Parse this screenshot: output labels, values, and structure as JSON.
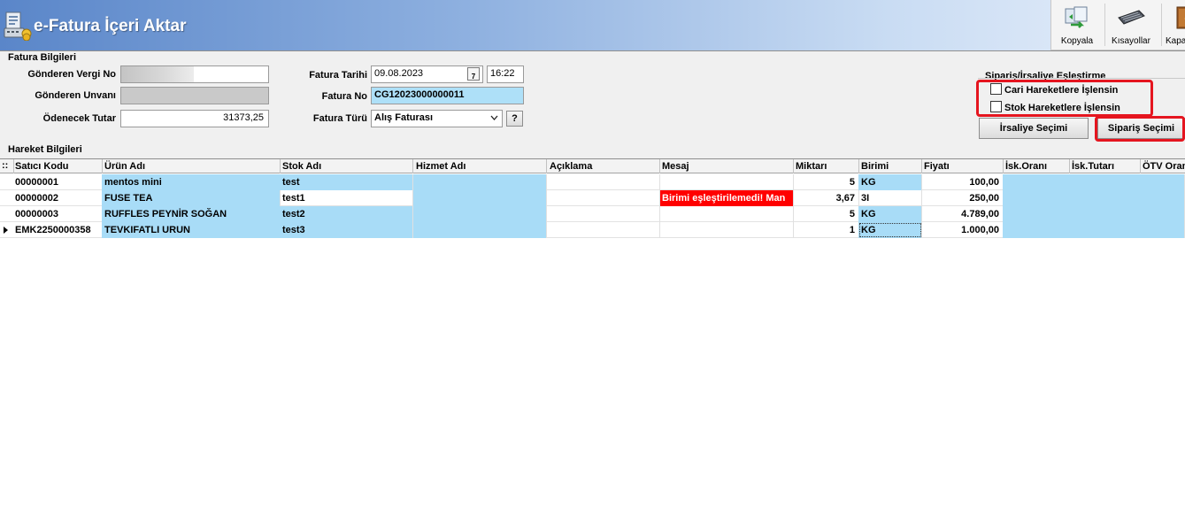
{
  "window": {
    "title": "e-Fatura İçeri Aktar"
  },
  "toolbar": {
    "buttons": [
      {
        "label": "Kopyala",
        "icon": "copy-icon"
      },
      {
        "label": "Kısayollar",
        "icon": "keyboard-icon"
      },
      {
        "label": "Kapat",
        "icon": "door-exit-icon"
      }
    ]
  },
  "fatura": {
    "section_label": "Fatura Bilgileri",
    "gonderen_vergi_no_label": "Gönderen Vergi No",
    "gonderen_unvani_label": "Gönderen Unvanı",
    "odenecek_tutar_label": "Ödenecek Tutar",
    "odenecek_tutar": "31373,25",
    "fatura_tarihi_label": "Fatura Tarihi",
    "fatura_tarihi": "09.08.2023",
    "fatura_saati": "16:22",
    "calendar_day": "7",
    "fatura_no_label": "Fatura No",
    "fatura_no": "CG12023000000011",
    "fatura_turu_label": "Fatura Türü",
    "fatura_turu": "Alış Faturası",
    "help_button": "?"
  },
  "eslestirme": {
    "title": "Sipariş/İrsaliye Eşleştirme",
    "cari_label": "Cari Hareketlere İşlensin",
    "stok_label": "Stok Hareketlere İşlensin",
    "cari_checked": false,
    "stok_checked": false,
    "irsaliye_button": "İrsaliye Seçimi",
    "siparis_button": "Sipariş Seçimi",
    "highlight_color": "#e5151f"
  },
  "hareket": {
    "section_label": "Hareket Bilgileri",
    "grip": "::",
    "columns": [
      "Satıcı Kodu",
      "Ürün Adı",
      "Stok Adı",
      "Hizmet Adı",
      "Açıklama",
      "Mesaj",
      "Miktarı",
      "Birimi",
      "Fiyatı",
      "İsk.Oranı",
      "İsk.Tutarı",
      "ÖTV Oranı"
    ],
    "rows": [
      {
        "satici_kodu": "00000001",
        "urun_adi": "mentos mini",
        "stok_adi": "test",
        "hizmet_adi": "",
        "aciklama": "",
        "mesaj": "",
        "miktari": "5",
        "birimi": "KG",
        "fiyati": "100,00",
        "isk_orani": "",
        "isk_tutari": "",
        "otv_orani": ""
      },
      {
        "satici_kodu": "00000002",
        "urun_adi": "FUSE TEA",
        "stok_adi": "test1",
        "hizmet_adi": "",
        "aciklama": "",
        "mesaj": "Birimi eşleştirilemedi! Man",
        "miktari": "3,67",
        "birimi": "3I",
        "fiyati": "250,00",
        "isk_orani": "",
        "isk_tutari": "",
        "otv_orani": ""
      },
      {
        "satici_kodu": "00000003",
        "urun_adi": "RUFFLES PEYNİR SOĞAN",
        "stok_adi": "test2",
        "hizmet_adi": "",
        "aciklama": "",
        "mesaj": "",
        "miktari": "5",
        "birimi": "KG",
        "fiyati": "4.789,00",
        "isk_orani": "",
        "isk_tutari": "",
        "otv_orani": ""
      },
      {
        "satici_kodu": "EMK2250000358",
        "urun_adi": "TEVKIFATLI URUN",
        "stok_adi": "test3",
        "hizmet_adi": "",
        "aciklama": "",
        "mesaj": "",
        "miktari": "1",
        "birimi": "KG",
        "fiyati": "1.000,00",
        "isk_orani": "",
        "isk_tutari": "",
        "otv_orani": ""
      }
    ],
    "current_row": 3,
    "error_color": "#ff0000",
    "editable_color": "#a8dcf7"
  }
}
